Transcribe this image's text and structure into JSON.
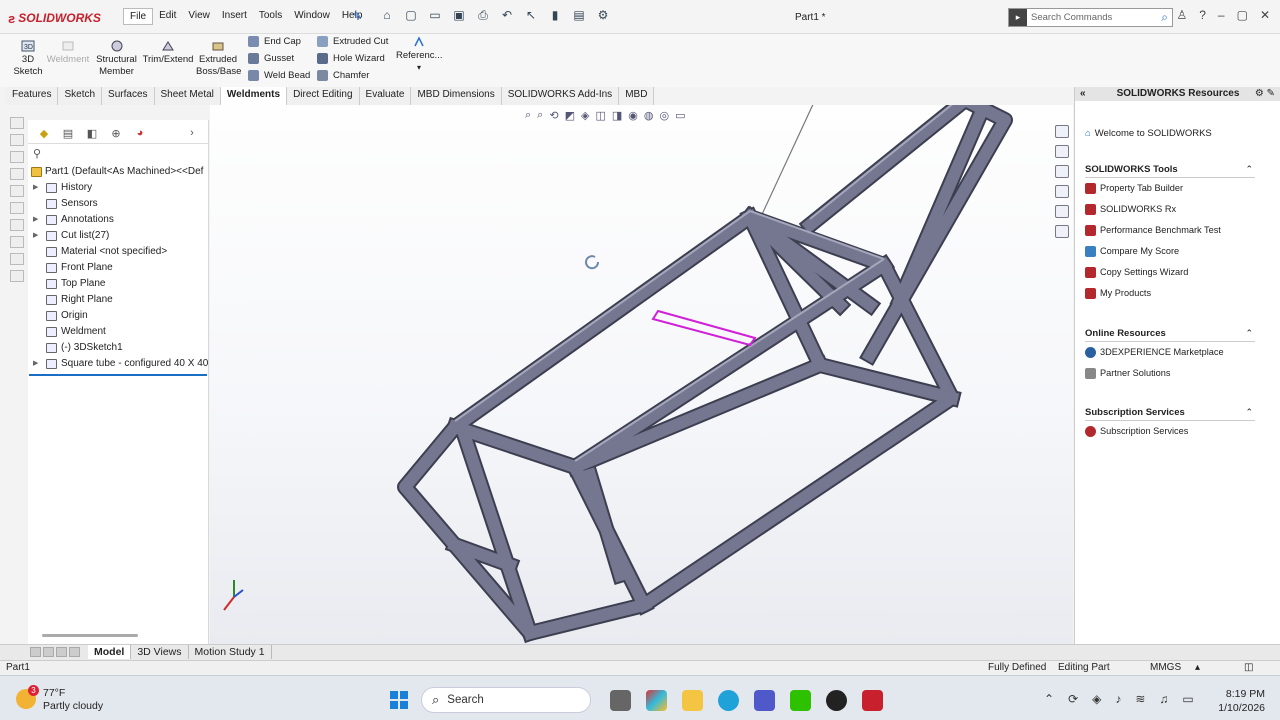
{
  "app": {
    "brand": "SOLIDWORKS",
    "document_title": "Part1 *",
    "menus": [
      "File",
      "Edit",
      "View",
      "Insert",
      "Tools",
      "Window",
      "Help"
    ],
    "search_placeholder": "Search Commands"
  },
  "ribbon": {
    "sketch3d": "3D Sketch",
    "weldment": "Weldment",
    "structural_member": "Structural Member",
    "trim_extend": "Trim/Extend",
    "extruded_boss": "Extruded Boss/Base",
    "end_cap": "End Cap",
    "gusset": "Gusset",
    "weld_bead": "Weld Bead",
    "extruded_cut": "Extruded Cut",
    "hole_wizard": "Hole Wizard",
    "chamfer": "Chamfer",
    "reference": "Referenc..."
  },
  "command_tabs": [
    "Features",
    "Sketch",
    "Surfaces",
    "Sheet Metal",
    "Weldments",
    "Direct Editing",
    "Evaluate",
    "MBD Dimensions",
    "SOLIDWORKS Add-Ins",
    "MBD"
  ],
  "active_command_tab": "Weldments",
  "tree": {
    "root": "Part1  (Default<As Machined><<Def",
    "items": [
      {
        "label": "History",
        "expand": true
      },
      {
        "label": "Sensors",
        "expand": false
      },
      {
        "label": "Annotations",
        "expand": true
      },
      {
        "label": "Cut list(27)",
        "expand": true
      },
      {
        "label": "Material <not specified>",
        "expand": false
      },
      {
        "label": "Front Plane",
        "expand": false
      },
      {
        "label": "Top Plane",
        "expand": false
      },
      {
        "label": "Right Plane",
        "expand": false
      },
      {
        "label": "Origin",
        "expand": false
      },
      {
        "label": "Weldment",
        "expand": false
      },
      {
        "label": "(-) 3DSketch1",
        "expand": false
      },
      {
        "label": "Square tube - configured 40 X 40",
        "expand": true
      }
    ]
  },
  "bottom_tabs": [
    "Model",
    "3D Views",
    "Motion Study 1"
  ],
  "active_bottom_tab": "Model",
  "status": {
    "doc": "Part1",
    "state": "Fully Defined",
    "mode": "Editing Part",
    "units": "MMGS"
  },
  "resources": {
    "title": "SOLIDWORKS Resources",
    "welcome": "Welcome to SOLIDWORKS",
    "sections": [
      {
        "title": "SOLIDWORKS Tools",
        "items": [
          "Property Tab Builder",
          "SOLIDWORKS Rx",
          "Performance Benchmark Test",
          "Compare My Score",
          "Copy Settings Wizard",
          "My Products"
        ]
      },
      {
        "title": "Online Resources",
        "items": [
          "3DEXPERIENCE Marketplace",
          "Partner Solutions"
        ]
      },
      {
        "title": "Subscription Services",
        "items": [
          "Subscription Services"
        ]
      }
    ]
  },
  "taskbar": {
    "temperature": "77°F",
    "weather": "Partly cloudy",
    "weather_badge": "3",
    "search": "Search",
    "time": "8:19 PM",
    "date": "1/10/2026"
  },
  "colors": {
    "brand_red": "#c8202c",
    "frame_gray": "#6c6e85",
    "highlight_magenta": "#d020d8",
    "tree_accent": "#1a6fc4"
  }
}
